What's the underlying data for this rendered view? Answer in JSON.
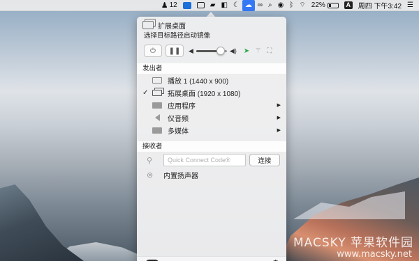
{
  "menubar": {
    "qq_count": "12",
    "battery": "22%",
    "input_method": "A",
    "clock": "周四 下午3:42"
  },
  "panel": {
    "title": "扩展桌面",
    "subtitle": "选择目标路径启动镜像",
    "controls": {
      "power_icon": "power-icon",
      "pause_icon": "pause-icon",
      "volume_level": 0.8
    },
    "senders": {
      "section_label": "发出者",
      "items": [
        {
          "label": "播放 1 (1440 x 900)",
          "checked": false,
          "has_submenu": false
        },
        {
          "label": "拓展桌面 (1920 x 1080)",
          "checked": true,
          "has_submenu": false
        },
        {
          "label": "应用程序",
          "checked": false,
          "has_submenu": true
        },
        {
          "label": "仪音频",
          "checked": false,
          "has_submenu": true
        },
        {
          "label": "多媒体",
          "checked": false,
          "has_submenu": true
        }
      ]
    },
    "receivers": {
      "section_label": "接收者",
      "quick_connect_placeholder": "Quick Connect Code®",
      "connect_label": "连接",
      "speaker_label": "内置扬声器"
    }
  },
  "watermark": {
    "line1": "MACSKY 苹果软件园",
    "line2": "www.macsky.net"
  }
}
